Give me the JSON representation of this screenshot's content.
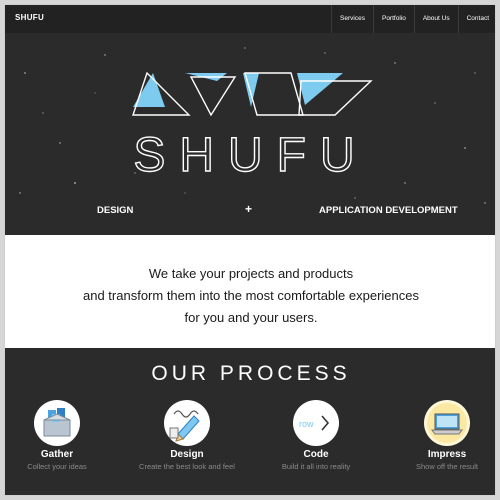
{
  "nav": {
    "brand": "SHUFU",
    "links": [
      "Services",
      "Portfolio",
      "About Us",
      "Contact"
    ]
  },
  "hero": {
    "logo_text": "SHUFU",
    "tagline_left": "DESIGN",
    "tagline_plus": "+",
    "tagline_right": "APPLICATION DEVELOPMENT",
    "accent_color": "#7ecbf0"
  },
  "intro": {
    "lines": [
      "We take your projects and products",
      "and transform them into the most comfortable experiences",
      "for you and your users."
    ]
  },
  "process": {
    "title": "OUR PROCESS",
    "steps": [
      {
        "label": "Gather",
        "desc": "Collect your ideas",
        "icon": "boxes-icon"
      },
      {
        "label": "Design",
        "desc": "Create the best look and feel",
        "icon": "pencil-icon"
      },
      {
        "label": "Code",
        "desc": "Build it all into reality",
        "icon": "code-icon",
        "icon_text": "row"
      },
      {
        "label": "Impress",
        "desc": "Show off the result",
        "icon": "laptop-icon"
      }
    ]
  }
}
